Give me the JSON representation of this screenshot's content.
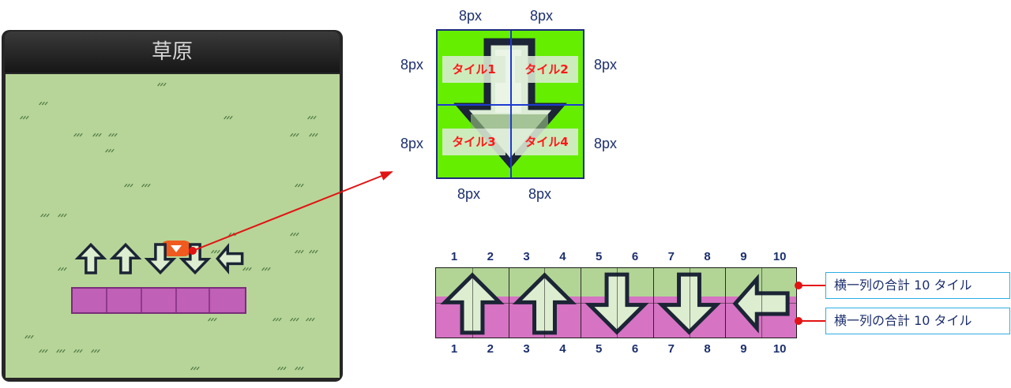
{
  "game": {
    "title": "草原",
    "grass_mark": "ᐟᐟᐟ",
    "arrows": [
      "up",
      "up",
      "down",
      "down",
      "left"
    ]
  },
  "zoom": {
    "tiles": [
      "タイル1",
      "タイル2",
      "タイル3",
      "タイル4"
    ],
    "top_labels": [
      "8px",
      "8px"
    ],
    "bottom_labels": [
      "8px",
      "8px"
    ],
    "left_labels": [
      "8px",
      "8px"
    ],
    "right_labels": [
      "8px",
      "8px"
    ]
  },
  "strip": {
    "numbers_top": [
      "1",
      "2",
      "3",
      "4",
      "5",
      "6",
      "7",
      "8",
      "9",
      "10"
    ],
    "numbers_bottom": [
      "1",
      "2",
      "3",
      "4",
      "5",
      "6",
      "7",
      "8",
      "9",
      "10"
    ],
    "arrows": [
      "up",
      "up",
      "down",
      "down",
      "left"
    ],
    "row_totals": [
      "横一列の合計 10 タイル",
      "横一列の合計 10 タイル"
    ]
  },
  "colors": {
    "grass": "#b7d598",
    "tile_green": "#66ee00",
    "strip_pink": "#d673c3",
    "label_red": "#ff1818",
    "annotation_blue": "#1c2f6e",
    "arrow_fill": "#ddeed0",
    "arrow_stroke": "#1b2535",
    "connector_red": "#e21313"
  }
}
